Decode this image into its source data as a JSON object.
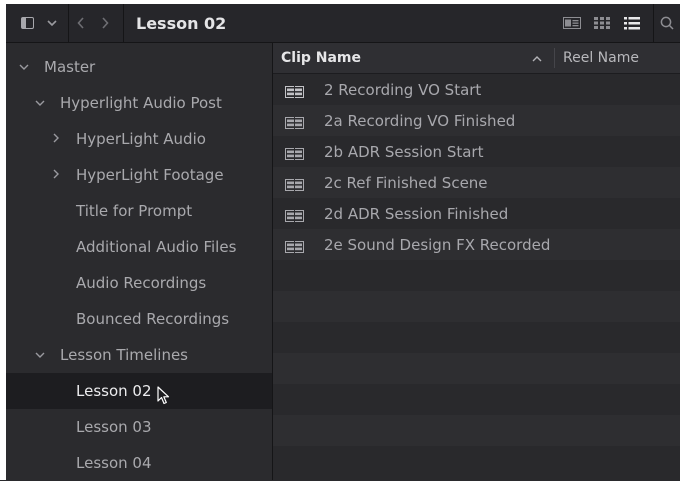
{
  "toolbar": {
    "title": "Lesson 02",
    "nav_back": "‹",
    "nav_forward": "›",
    "dropdown": "⌄"
  },
  "sidebar": {
    "items": [
      {
        "label": "Master",
        "chevron": "⌄"
      },
      {
        "label": "Hyperlight Audio Post",
        "chevron": "⌄"
      },
      {
        "label": "HyperLight Audio",
        "chevron": "›"
      },
      {
        "label": "HyperLight Footage",
        "chevron": "›"
      },
      {
        "label": "Title for Prompt",
        "chevron": ""
      },
      {
        "label": "Additional Audio Files",
        "chevron": ""
      },
      {
        "label": "Audio Recordings",
        "chevron": ""
      },
      {
        "label": "Bounced Recordings",
        "chevron": ""
      },
      {
        "label": "Lesson Timelines",
        "chevron": "⌄"
      },
      {
        "label": "Lesson 02",
        "chevron": "",
        "selected": true
      },
      {
        "label": "Lesson 03",
        "chevron": ""
      },
      {
        "label": "Lesson 04",
        "chevron": ""
      }
    ]
  },
  "clip_list": {
    "columns": {
      "clip_name": "Clip Name",
      "sort_indicator": "^",
      "reel_name": "Reel Name"
    },
    "rows": [
      {
        "name": "2 Recording VO Start"
      },
      {
        "name": "2a Recording VO Finished"
      },
      {
        "name": "2b ADR Session Start"
      },
      {
        "name": "2c Ref Finished Scene"
      },
      {
        "name": "2d ADR Session Finished"
      },
      {
        "name": "2e Sound Design FX Recorded"
      }
    ]
  },
  "colors": {
    "background": "#2a2a2d",
    "selected_row": "#1d1d20",
    "header_text": "#e6e6e8"
  }
}
